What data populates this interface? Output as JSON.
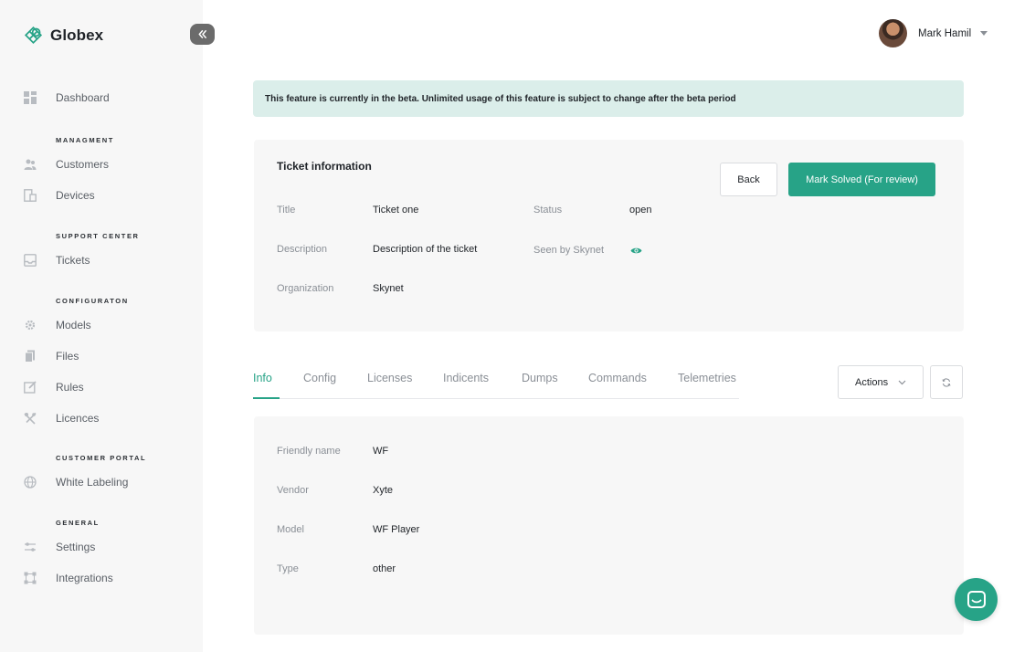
{
  "brand": {
    "name": "Globex",
    "accent": "#27a387"
  },
  "sidebar": {
    "dashboard": "Dashboard",
    "sections": {
      "management": "MANAGMENT",
      "support": "SUPPORT CENTER",
      "configuration": "CONFIGURATON",
      "portal": "CUSTOMER PORTAL",
      "general": "GENERAL"
    },
    "items": {
      "customers": "Customers",
      "devices": "Devices",
      "tickets": "Tickets",
      "models": "Models",
      "files": "Files",
      "rules": "Rules",
      "licences": "Licences",
      "white_labeling": "White Labeling",
      "settings": "Settings",
      "integrations": "Integrations"
    }
  },
  "header": {
    "user_name": "Mark Hamil"
  },
  "banner": {
    "text": "This feature is currently in the beta. Unlimited usage of this feature is subject to change after the beta period"
  },
  "ticket": {
    "heading": "Ticket information",
    "back_label": "Back",
    "solve_label": "Mark Solved (For review)",
    "fields": {
      "title_label": "Title",
      "title_value": "Ticket one",
      "description_label": "Description",
      "description_value": "Description of the ticket",
      "organization_label": "Organization",
      "organization_value": "Skynet",
      "status_label": "Status",
      "status_value": "open",
      "seen_label": "Seen by Skynet"
    }
  },
  "tabs": [
    "Info",
    "Config",
    "Licenses",
    "Indicents",
    "Dumps",
    "Commands",
    "Telemetries"
  ],
  "actions_label": "Actions",
  "info": {
    "friendly_name_label": "Friendly name",
    "friendly_name_value": "WF",
    "vendor_label": "Vendor",
    "vendor_value": "Xyte",
    "model_label": "Model",
    "model_value": "WF Player",
    "type_label": "Type",
    "type_value": "other"
  }
}
